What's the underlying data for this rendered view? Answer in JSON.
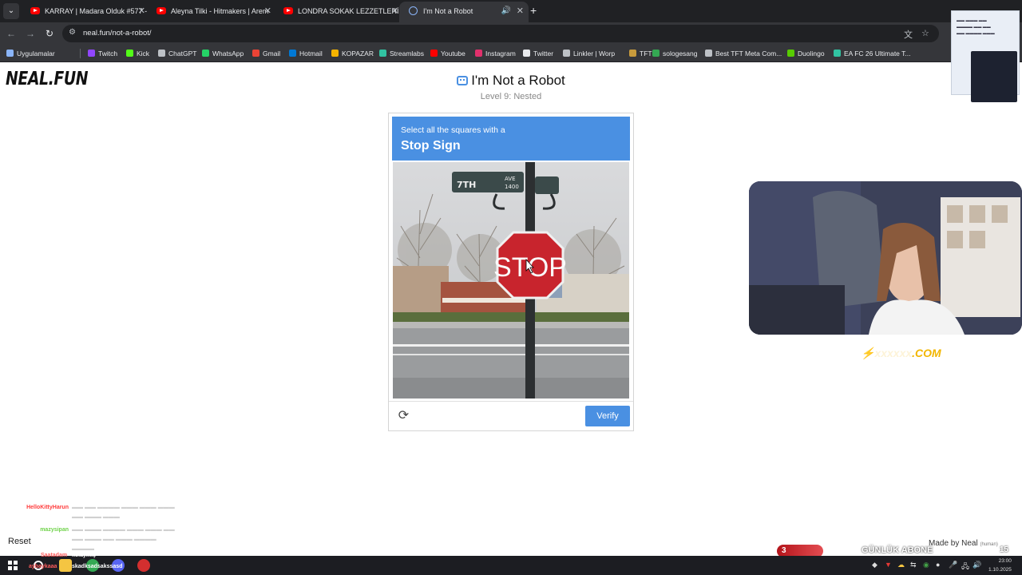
{
  "browser": {
    "tabs": [
      {
        "title": "KARRAY | Madara Olduk #577 -"
      },
      {
        "title": "Aleyna Tilki - Hitmakers | Arem"
      },
      {
        "title": "LONDRA SOKAK LEZZETLERİNİ"
      },
      {
        "title": "I'm Not a Robot"
      }
    ],
    "url": "neal.fun/not-a-robot/",
    "bookmarks": [
      {
        "label": "Uygulamalar",
        "color": "#8ab4f8"
      },
      {
        "label": "Twitch",
        "color": "#9146ff"
      },
      {
        "label": "Kick",
        "color": "#53fc18"
      },
      {
        "label": "ChatGPT",
        "color": "#bdc1c6"
      },
      {
        "label": "WhatsApp",
        "color": "#25d366"
      },
      {
        "label": "Gmail",
        "color": "#ea4335"
      },
      {
        "label": "Hotmail",
        "color": "#0078d4"
      },
      {
        "label": "KOPAZAR",
        "color": "#f5b400"
      },
      {
        "label": "Streamlabs",
        "color": "#31c3a2"
      },
      {
        "label": "Youtube",
        "color": "#ff0000"
      },
      {
        "label": "Instagram",
        "color": "#e1306c"
      },
      {
        "label": "Twitter",
        "color": "#e8eaed"
      },
      {
        "label": "Linkler | Worp",
        "color": "#bdc1c6"
      },
      {
        "label": "TFT",
        "color": "#c89b3c"
      },
      {
        "label": "sologesang",
        "color": "#34a853"
      },
      {
        "label": "Best TFT Meta Com...",
        "color": "#bdc1c6"
      },
      {
        "label": "Duolingo",
        "color": "#58cc02"
      },
      {
        "label": "EA FC 26 Ultimate T...",
        "color": "#31c3a2"
      }
    ]
  },
  "page": {
    "logo": "NEAL.FUN",
    "title": "I'm Not a Robot",
    "level": "Level 9: Nested",
    "reset": "Reset",
    "made_by": "Made by Neal",
    "made_by_note": "(human)"
  },
  "captcha": {
    "instruction": "Select all the squares with a",
    "target": "Stop Sign",
    "verify_label": "Verify",
    "image": {
      "sign_text": "STOP",
      "street_name": "7TH",
      "street_suffix": "AVE",
      "block_number": "1400"
    },
    "accent_color": "#4a90e2"
  },
  "stream_overlay": {
    "promo_text": ".COM",
    "sub_goal_count": "3",
    "sub_goal_label": "GÜNLÜK ABONE",
    "sub_goal_target": "15",
    "chat": [
      {
        "nick": "HelloKittyHarun",
        "nick_color": "#ff3b3b",
        "message": "—"
      },
      {
        "nick": "mazysipan",
        "nick_color": "#6fd24a",
        "message": "—"
      }
    ],
    "alert_name_1": "Saatadam",
    "alert_msg_1": "kolaymış",
    "alert_name_2": "aybaykaaa",
    "alert_msg_2": "skadksadsakssasd"
  },
  "taskbar": {
    "time": "23:00",
    "date": "1.10.2025"
  }
}
